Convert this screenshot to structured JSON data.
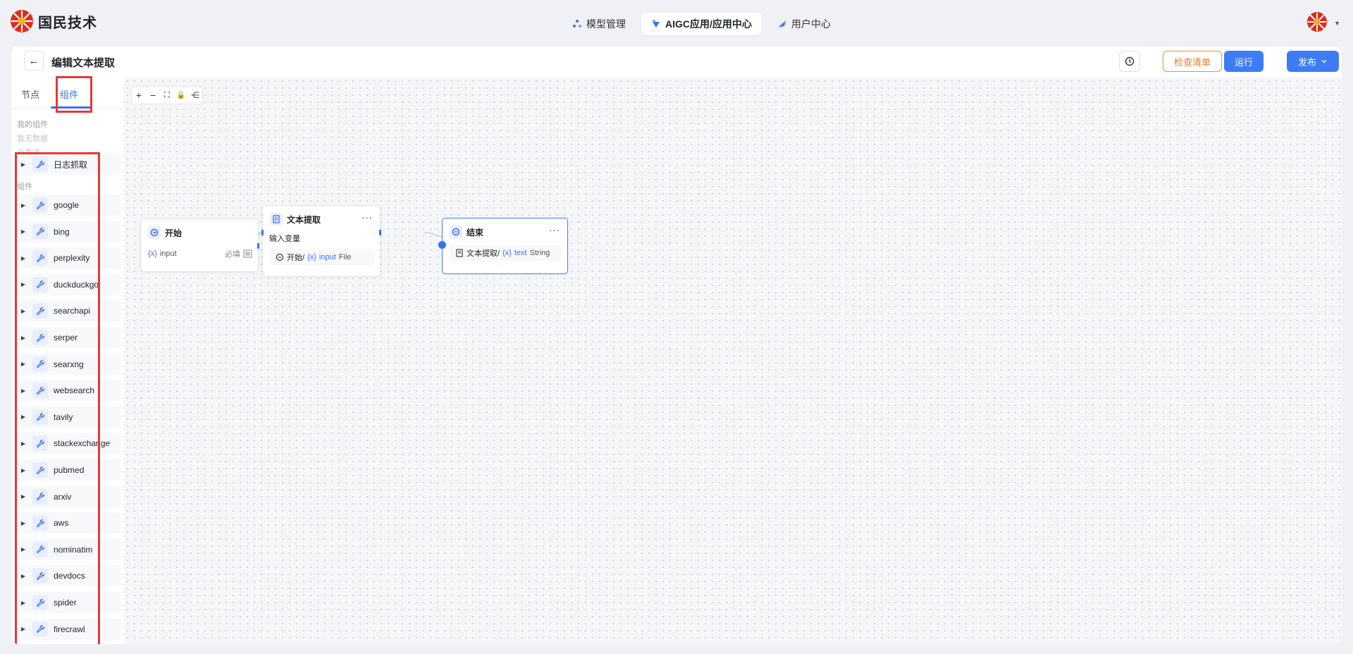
{
  "brand": {
    "name": "国民技术"
  },
  "nav": [
    {
      "label": "模型管理",
      "active": false,
      "icon": "model-icon"
    },
    {
      "label": "AIGC应用/应用中心",
      "active": true,
      "icon": "app-icon"
    },
    {
      "label": "用户中心",
      "active": false,
      "icon": "user-icon"
    }
  ],
  "header": {
    "title": "编辑文本提取",
    "check_label": "检查清单",
    "run_label": "运行",
    "publish_label": "发布"
  },
  "sidebar": {
    "tabs": [
      {
        "label": "节点"
      },
      {
        "label": "组件"
      }
    ],
    "my_components_label": "我的组件",
    "empty_label": "暂无数据",
    "workflow_label": "业务流",
    "workflow_items": [
      "日志抓取"
    ],
    "components_label": "组件",
    "components": [
      "google",
      "bing",
      "perplexity",
      "duckduckgo",
      "searchapi",
      "serper",
      "searxng",
      "websearch",
      "tavily",
      "stackexchange",
      "pubmed",
      "arxiv",
      "aws",
      "nominatim",
      "devdocs",
      "spider",
      "firecrawl"
    ]
  },
  "canvas": {
    "toolbar": [
      "+",
      "−",
      "⛶",
      "🔒",
      "⋲"
    ],
    "nodes": {
      "start": {
        "title": "开始",
        "var_tag": "{x}",
        "var_name": "input",
        "required": "必填"
      },
      "extract": {
        "title": "文本提取",
        "section": "输入变量",
        "source": "开始/",
        "var_tag": "{x}",
        "var_name": "input",
        "var_type": "File"
      },
      "end": {
        "title": "结束",
        "source": "文本提取/",
        "var_tag": "{x}",
        "var_name": "text",
        "var_type": "String"
      }
    }
  },
  "colors": {
    "accent": "#3d6ff5",
    "warning": "#f07b22",
    "highlight": "#e53935"
  }
}
